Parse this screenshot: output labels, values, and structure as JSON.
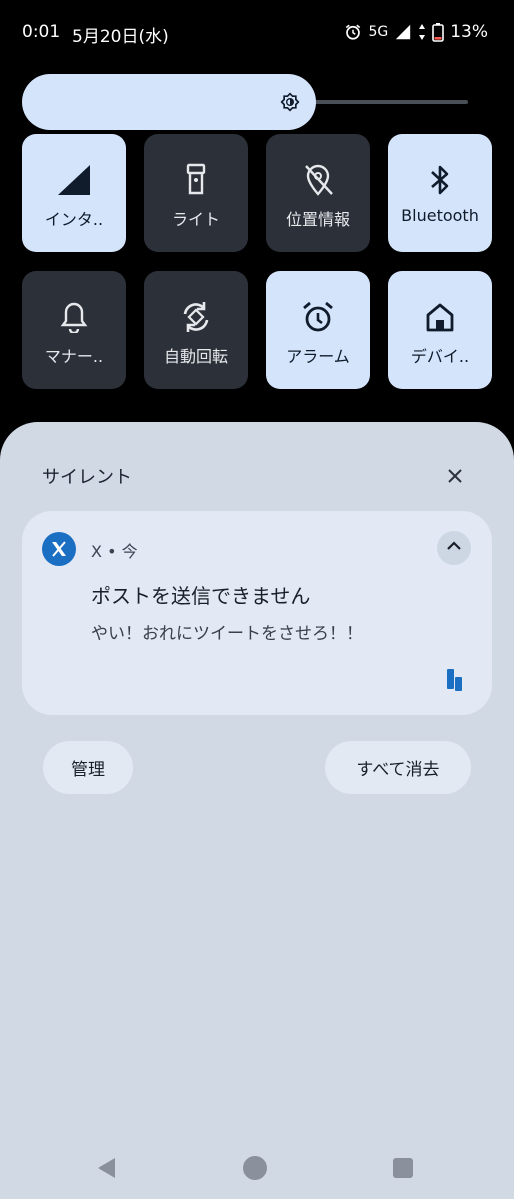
{
  "status": {
    "time": "0:01",
    "date": "5月20日(水)",
    "network": "5G",
    "battery": "13%",
    "icons": [
      "alarm-icon",
      "signal-icon",
      "data-arrows-icon",
      "battery-icon"
    ]
  },
  "brightness": {
    "level_percent": 66,
    "icon": "brightness-icon"
  },
  "tiles": [
    {
      "label": "インタ..",
      "icon": "signal-icon",
      "state": "on"
    },
    {
      "label": "ライト",
      "icon": "flashlight-icon",
      "state": "off"
    },
    {
      "label": "位置情報",
      "icon": "location-off-icon",
      "state": "off"
    },
    {
      "label": "Bluetooth",
      "icon": "bluetooth-icon",
      "state": "on"
    },
    {
      "label": "マナー..",
      "icon": "bell-icon",
      "state": "off"
    },
    {
      "label": "自動回転",
      "icon": "rotate-icon",
      "state": "off"
    },
    {
      "label": "アラーム",
      "icon": "alarm-icon",
      "state": "on"
    },
    {
      "label": "デバイ..",
      "icon": "home-icon",
      "state": "on"
    }
  ],
  "notifications": {
    "section_title": "サイレント",
    "items": [
      {
        "app": "X",
        "separator": "•",
        "time": "今",
        "title": "ポストを送信できません",
        "body": "やい！おれにツイートをさせろ！！"
      }
    ]
  },
  "actions": {
    "manage_label": "管理",
    "clear_all_label": "すべて消去"
  },
  "colors": {
    "tile_on": "#d4e4fb",
    "tile_off": "#2c3139",
    "panel_bg": "#d1d9e5",
    "app_icon_bg": "#1b6fc2"
  }
}
